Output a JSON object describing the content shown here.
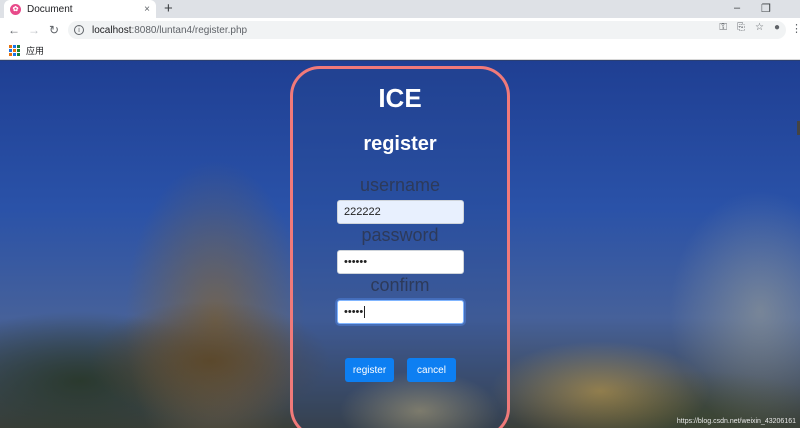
{
  "browser": {
    "tab_title": "Document",
    "tab_favicon": "favicon-icon",
    "tab_close": "×",
    "new_tab": "+",
    "win_minimize": "–",
    "win_restore": "❐",
    "url_host": "localhost",
    "url_rest": ":8080/luntan4/register.php",
    "bookmark_apps_label": "应用"
  },
  "form": {
    "brand": "ICE",
    "heading": "register",
    "username_label": "username",
    "username_value": "222222",
    "password_label": "password",
    "password_value": "••••••",
    "confirm_label": "confirm",
    "confirm_value": "•••••",
    "register_button": "register",
    "cancel_button": "cancel"
  },
  "watermark": "https://blog.csdn.net/weixin_43206161",
  "colors": {
    "accent": "#0d7ff2",
    "card_border": "#f07a7a",
    "sky": "#2a52a8"
  }
}
